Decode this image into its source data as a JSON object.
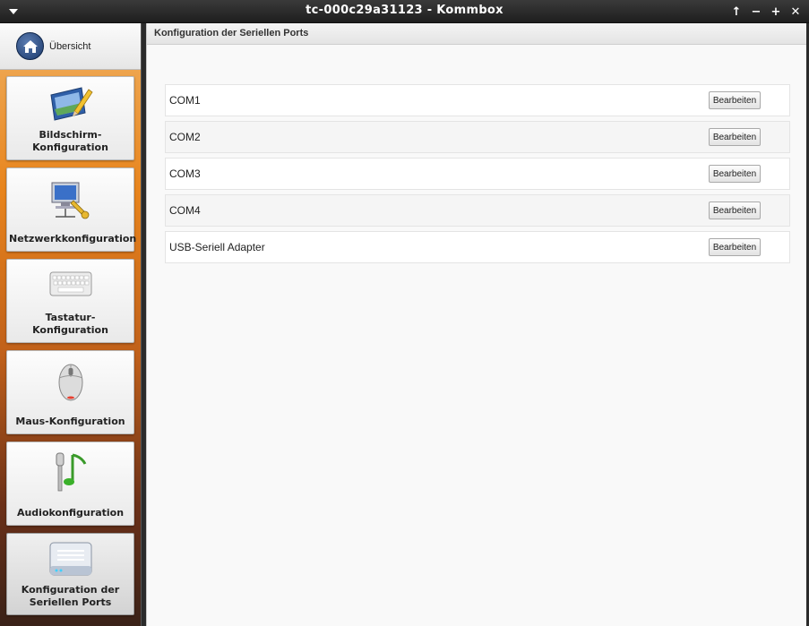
{
  "window": {
    "title": "tc-000c29a31123 - Kommbox",
    "controls": [
      "↑",
      "−",
      "+",
      "✕"
    ]
  },
  "sidebar": {
    "overview_label": "Übersicht",
    "items": [
      {
        "label": "Bildschirm-\nKonfiguration",
        "icon": "monitor-pencil-icon"
      },
      {
        "label": "Netzwerkkonfiguration",
        "icon": "network-computer-icon"
      },
      {
        "label": "Tastatur-\nKonfiguration",
        "icon": "keyboard-icon"
      },
      {
        "label": "Maus-Konfiguration",
        "icon": "mouse-icon"
      },
      {
        "label": "Audiokonfiguration",
        "icon": "microphone-music-icon"
      },
      {
        "label": "Konfiguration der\nSeriellen Ports",
        "icon": "serial-device-icon",
        "active": true
      }
    ]
  },
  "main": {
    "header": "Konfiguration der Seriellen Ports",
    "ports": [
      {
        "name": "COM1",
        "button": "Bearbeiten"
      },
      {
        "name": "COM2",
        "button": "Bearbeiten"
      },
      {
        "name": "COM3",
        "button": "Bearbeiten"
      },
      {
        "name": "COM4",
        "button": "Bearbeiten"
      },
      {
        "name": "USB-Seriell Adapter",
        "button": "Bearbeiten"
      }
    ]
  },
  "colors": {
    "titlebar": "#2a2a2a",
    "sidebar_top": "#f0b060",
    "sidebar_mid": "#e8841c",
    "sidebar_bottom": "#3a2218",
    "content_bg": "#f9f9f9"
  }
}
